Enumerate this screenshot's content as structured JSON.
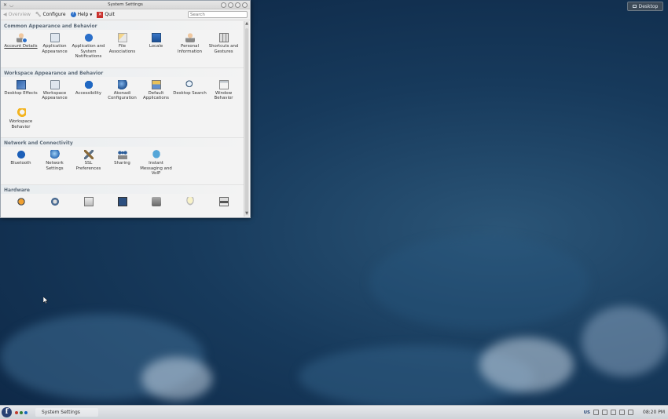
{
  "window": {
    "title": "System Settings",
    "toolbar": {
      "overview": "Overview",
      "configure": "Configure",
      "help": "Help",
      "quit": "Quit",
      "search_placeholder": "Search"
    }
  },
  "sections": [
    {
      "title": "Common Appearance and Behavior",
      "items": [
        {
          "label": "Account Details",
          "icon": "account-details-icon"
        },
        {
          "label": "Application Appearance",
          "icon": "application-appearance-icon"
        },
        {
          "label": "Application and System Notifications",
          "icon": "notifications-icon"
        },
        {
          "label": "File Associations",
          "icon": "file-associations-icon"
        },
        {
          "label": "Locale",
          "icon": "locale-icon"
        },
        {
          "label": "Personal Information",
          "icon": "personal-information-icon"
        },
        {
          "label": "Shortcuts and Gestures",
          "icon": "shortcuts-icon"
        }
      ]
    },
    {
      "title": "Workspace Appearance and Behavior",
      "items": [
        {
          "label": "Desktop Effects",
          "icon": "desktop-effects-icon"
        },
        {
          "label": "Workspace Appearance",
          "icon": "workspace-appearance-icon"
        },
        {
          "label": "Accessibility",
          "icon": "accessibility-icon"
        },
        {
          "label": "Akonadi Configuration",
          "icon": "akonadi-icon"
        },
        {
          "label": "Default Applications",
          "icon": "default-applications-icon"
        },
        {
          "label": "Desktop Search",
          "icon": "desktop-search-icon"
        },
        {
          "label": "Window Behavior",
          "icon": "window-behavior-icon"
        },
        {
          "label": "Workspace Behavior",
          "icon": "workspace-behavior-icon"
        }
      ]
    },
    {
      "title": "Network and Connectivity",
      "items": [
        {
          "label": "Bluetooth",
          "icon": "bluetooth-icon"
        },
        {
          "label": "Network Settings",
          "icon": "network-settings-icon"
        },
        {
          "label": "SSL Preferences",
          "icon": "ssl-preferences-icon"
        },
        {
          "label": "Sharing",
          "icon": "sharing-icon"
        },
        {
          "label": "Instant Messaging and VoIP",
          "icon": "instant-messaging-icon"
        }
      ]
    },
    {
      "title": "Hardware",
      "items": []
    }
  ],
  "desktop": {
    "button": "Desktop"
  },
  "taskbar": {
    "task": "System Settings",
    "keyboard_layout": "US",
    "clock": "08:20 PM"
  }
}
